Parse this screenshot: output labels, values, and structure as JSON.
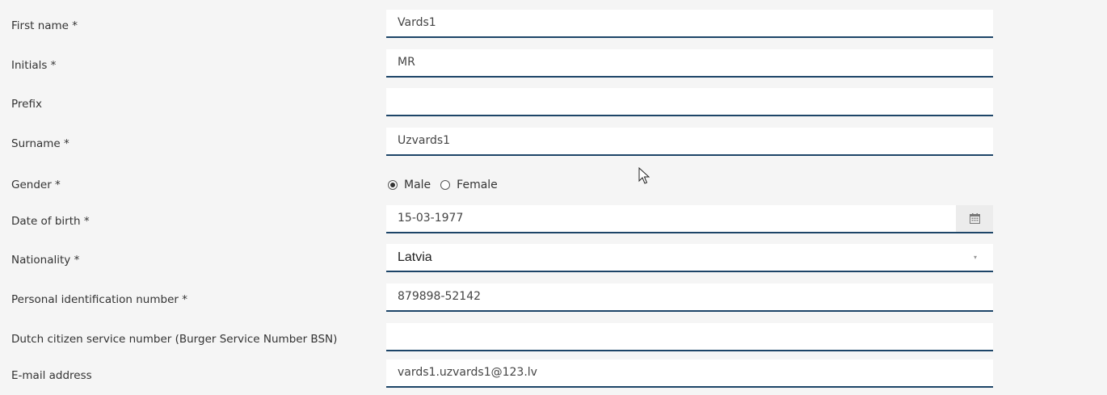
{
  "form": {
    "first_name": {
      "label": "First name *",
      "value": "Vards1"
    },
    "initials": {
      "label": "Initials *",
      "value": "MR"
    },
    "prefix": {
      "label": "Prefix",
      "value": ""
    },
    "surname": {
      "label": "Surname *",
      "value": "Uzvards1"
    },
    "gender": {
      "label": "Gender *",
      "options": [
        "Male",
        "Female"
      ],
      "selected": "Male"
    },
    "date_of_birth": {
      "label": "Date of birth *",
      "value": "15-03-1977",
      "icon": "calendar-icon"
    },
    "nationality": {
      "label": "Nationality *",
      "value": "Latvia",
      "caret": "▾"
    },
    "personal_id": {
      "label": "Personal identification number *",
      "value": "879898-52142"
    },
    "bsn": {
      "label": "Dutch citizen service number (Burger Service Number BSN)",
      "value": ""
    },
    "email": {
      "label": "E-mail address",
      "value": "vards1.uzvards1@123.lv"
    }
  },
  "colors": {
    "background": "#f5f5f5",
    "field_background": "#ffffff",
    "field_underline": "#1d4568",
    "calendar_button": "#ececec"
  }
}
